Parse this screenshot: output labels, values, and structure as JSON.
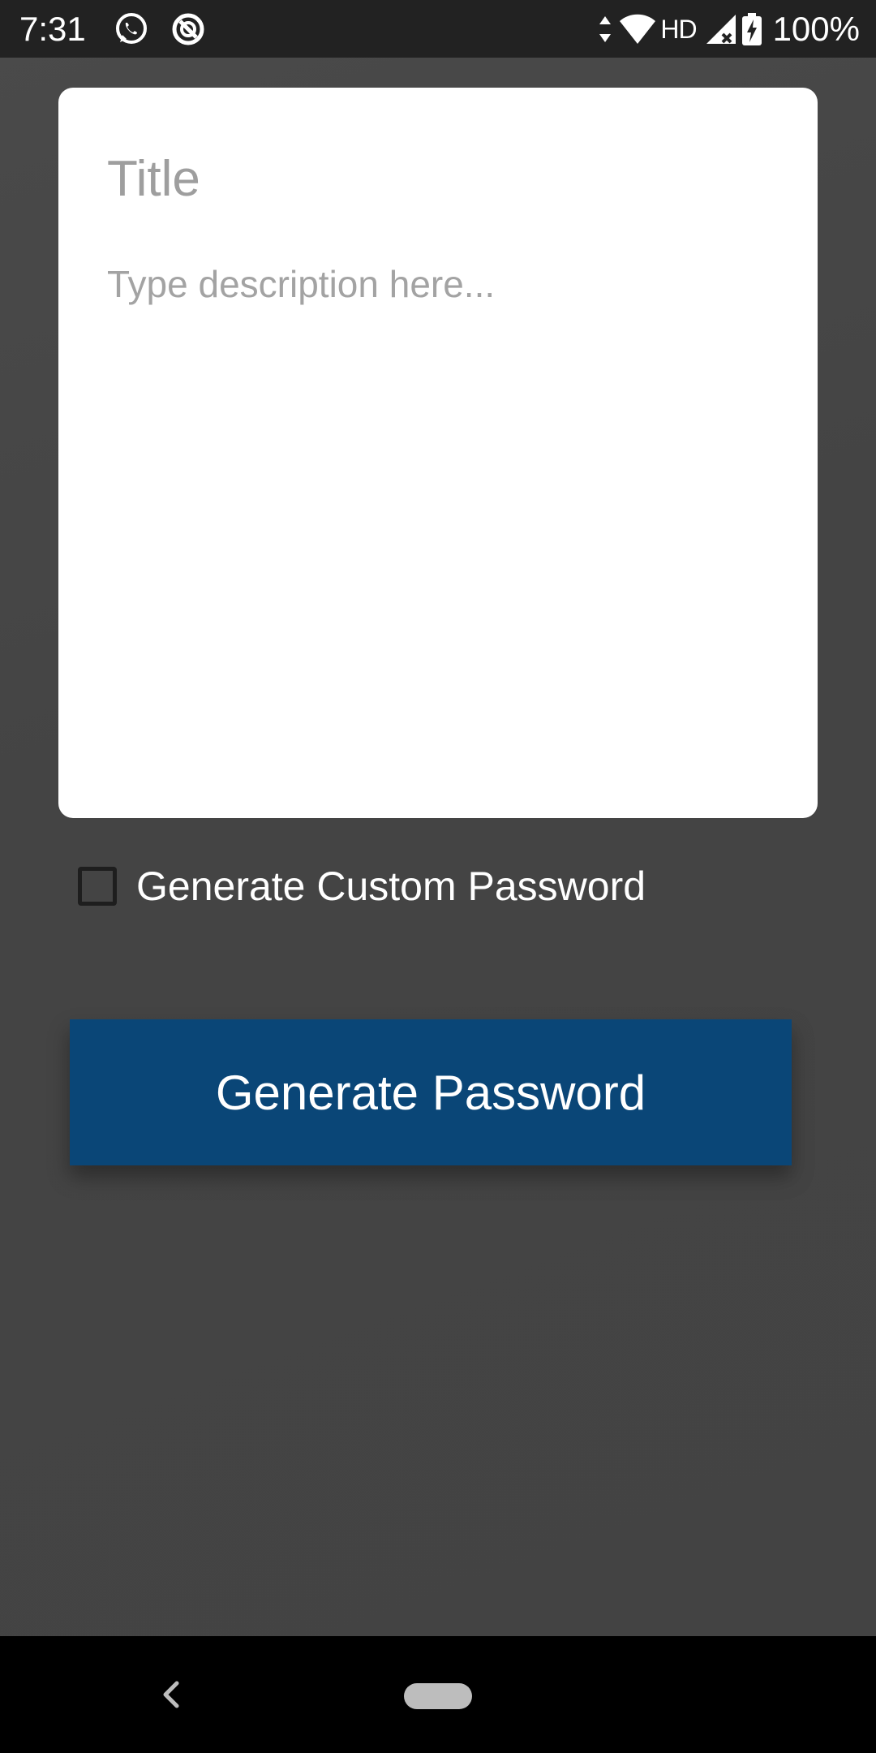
{
  "status_bar": {
    "time": "7:31",
    "left_icons": [
      "whatsapp-icon",
      "data-saver-icon"
    ],
    "right_icons": [
      "data-arrows-icon",
      "wifi-icon",
      "signal-icon",
      "battery-charging-icon"
    ],
    "hd_label": "HD",
    "battery_percent": "100%"
  },
  "note": {
    "title_placeholder": "Title",
    "title_value": "",
    "description_placeholder": "Type description here...",
    "description_value": ""
  },
  "options": {
    "custom_password_label": "Generate Custom Password",
    "custom_password_checked": false
  },
  "actions": {
    "generate_label": "Generate Password"
  },
  "nav": {
    "back_icon": "back-icon",
    "home_icon": "home-pill-icon"
  },
  "colors": {
    "background": "#444444",
    "status_bar": "#222222",
    "button": "#0a4677",
    "card": "#ffffff"
  }
}
